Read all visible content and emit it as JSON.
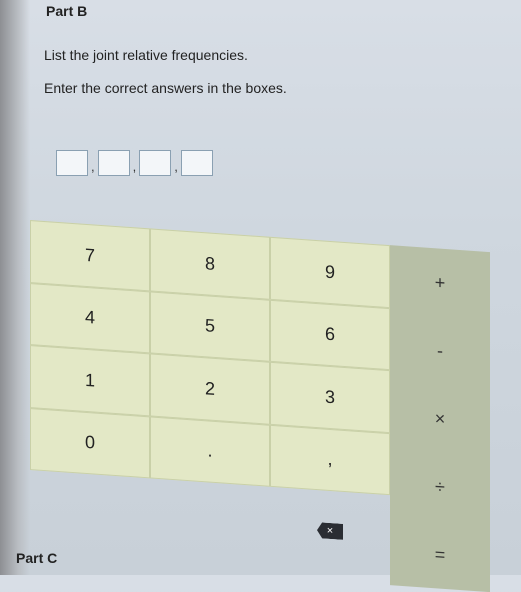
{
  "part_b": "Part B",
  "instructions": {
    "line1": "List the joint relative frequencies.",
    "line2": "Enter the correct answers in the boxes."
  },
  "answer_separator": ",",
  "keypad": {
    "digits": [
      "7",
      "8",
      "9",
      "4",
      "5",
      "6",
      "1",
      "2",
      "3",
      "0",
      ".",
      ","
    ],
    "operators": [
      "+",
      "-",
      "×",
      "÷",
      "="
    ],
    "backspace_glyph": "×"
  },
  "part_c": "Part C"
}
